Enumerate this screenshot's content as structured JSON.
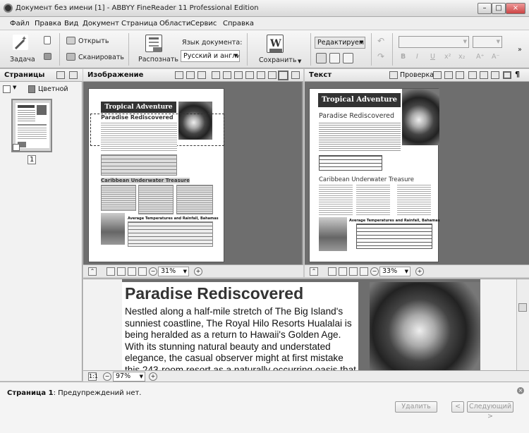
{
  "window": {
    "title": "Документ без имени [1] - ABBYY FineReader 11 Professional Edition"
  },
  "menu": [
    "Файл",
    "Правка",
    "Вид",
    "Документ",
    "Страница",
    "Области",
    "Сервис",
    "Справка"
  ],
  "ribbon": {
    "task": "Задача",
    "open": "Открыть",
    "scan": "Сканировать",
    "recognize": "Распознать",
    "doc_lang_label": "Язык документа:",
    "doc_lang_value": "Русский и англи",
    "save": "Сохранить",
    "edit_mode": "Редактируемі"
  },
  "pages_panel": {
    "title": "Страницы",
    "color_mode": "Цветной",
    "page_number": "1"
  },
  "image_panel": {
    "title": "Изображение",
    "zoom": "31%"
  },
  "text_panel": {
    "title": "Текст",
    "check": "Проверка",
    "zoom": "33%"
  },
  "doc": {
    "title": "Tropical Adventure",
    "h1": "Paradise Rediscovered",
    "h2": "Caribbean Underwater Treasure",
    "table_caption": "Average Temperatures and Rainfall, Bahamas"
  },
  "zoom_panel": {
    "heading": "Paradise Rediscovered",
    "body": "Nestled along a half-mile stretch of The Big Island's sunniest coastline, The Royal Hilo Resorts Hualalai is being heralded as a return to Hawaii's Golden Age. With its stunning natural beauty and understated elegance, the casual observer might at first mistake this 243-room resort as a naturally occurring oasis that had arisen from its black-lava surroundings. Yet, once on the property, the warm, personal service and attention to detail",
    "zoom": "97%"
  },
  "status": {
    "page_label": "Страница 1",
    "message": ": Предупреждений нет.",
    "delete": "Удалить",
    "prev": "<",
    "next": "Следующий >"
  }
}
